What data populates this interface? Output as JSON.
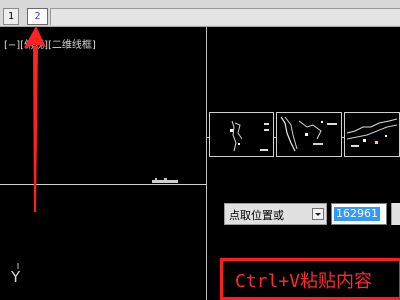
{
  "tabs": [
    {
      "label": "1"
    },
    {
      "label": "2",
      "active": true
    }
  ],
  "viewport": {
    "label": "[−][俯视][二维线框]",
    "ucs_axis_label": "Y"
  },
  "properties": {
    "combo_label": "点取位置或",
    "value": "162961"
  },
  "annotation": {
    "text": "Ctrl+V粘贴内容"
  },
  "colors": {
    "accent_red": "#ff1e1e",
    "selection_blue": "#3399ff",
    "tab_active_text": "#5a2ecf"
  },
  "icons": [
    "chevron-down-icon",
    "red-arrow-annotation"
  ]
}
